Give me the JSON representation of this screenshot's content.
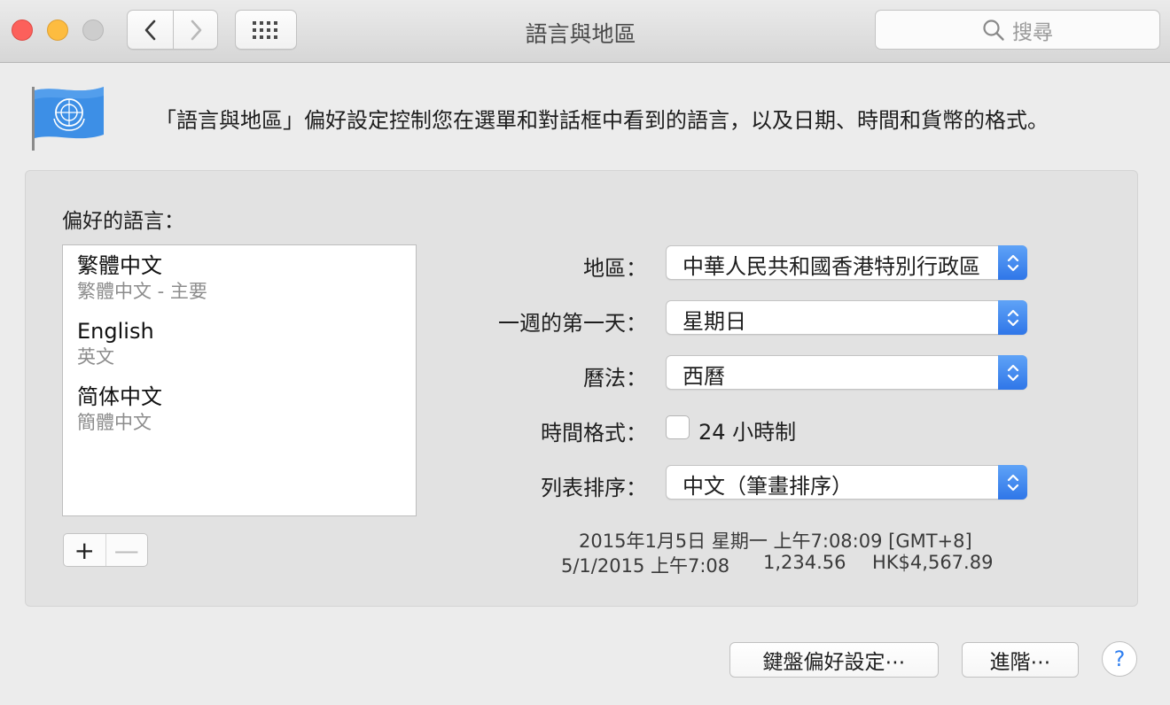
{
  "window": {
    "title": "語言與地區",
    "search_placeholder": "搜尋"
  },
  "header": {
    "description": "「語言與地區」偏好設定控制您在選單和對話框中看到的語言，以及日期、時間和貨幣的格式。"
  },
  "languages": {
    "title": "偏好的語言：",
    "items": [
      {
        "name": "繁體中文",
        "sub": "繁體中文 - 主要"
      },
      {
        "name": "English",
        "sub": "英文"
      },
      {
        "name": "简体中文",
        "sub": "簡體中文"
      }
    ],
    "add": "+",
    "remove": "—"
  },
  "settings": {
    "region": {
      "label": "地區：",
      "value": "中華人民共和國香港特別行政區"
    },
    "first_day": {
      "label": "一週的第一天：",
      "value": "星期日"
    },
    "calendar": {
      "label": "曆法：",
      "value": "西曆"
    },
    "time_format": {
      "label": "時間格式：",
      "checkbox_label": "24 小時制",
      "checked": false
    },
    "list_sort": {
      "label": "列表排序：",
      "value": "中文（筆畫排序）"
    }
  },
  "sample": {
    "long_date": "2015年1月5日 星期一 上午7:08:09 [GMT+8]",
    "short_date": "5/1/2015 上午7:08",
    "number": "1,234.56",
    "currency": "HK$4,567.89"
  },
  "footer": {
    "keyboard_button": "鍵盤偏好設定⋯",
    "advanced_button": "進階⋯",
    "help": "?"
  },
  "colors": {
    "accent": "#2f76e8",
    "close": "#fc605b",
    "minimize": "#fdbc40"
  }
}
